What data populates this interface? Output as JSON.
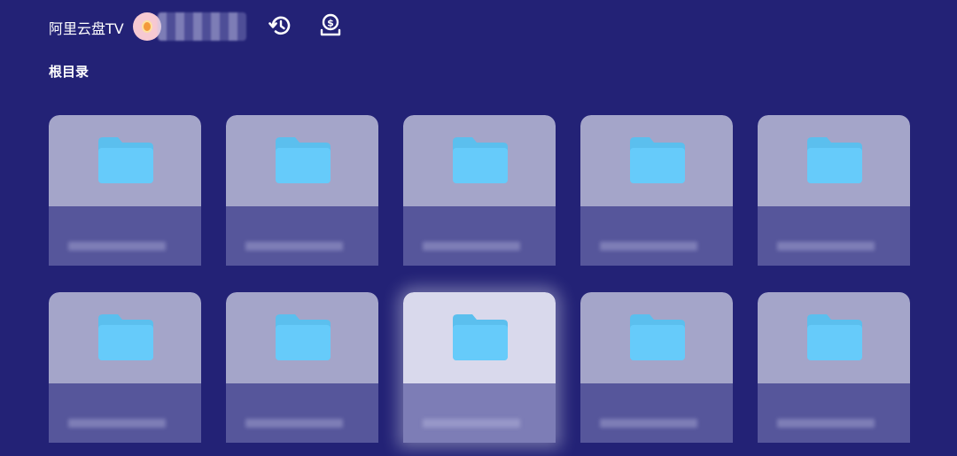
{
  "header": {
    "app_title": "阿里云盘TV",
    "username": "",
    "avatar_icon": "avatar-icon",
    "history_icon": "history-icon",
    "sponsor_icon": "donate-icon"
  },
  "breadcrumb": "根目录",
  "colors": {
    "background": "#232276",
    "card": "#a4a5c9",
    "card_focused": "#d9d9ec",
    "folder": "#5fc6f5"
  },
  "folders": [
    {
      "name": "",
      "date": ""
    },
    {
      "name": "",
      "date": ""
    },
    {
      "name": "",
      "date": ""
    },
    {
      "name": "",
      "date": ""
    },
    {
      "name": "",
      "date": ""
    },
    {
      "name": "",
      "date": ""
    },
    {
      "name": "",
      "date": ""
    },
    {
      "name": "",
      "date": ""
    },
    {
      "name": "",
      "date": ""
    },
    {
      "name": "",
      "date": ""
    }
  ],
  "focused_index": 7
}
